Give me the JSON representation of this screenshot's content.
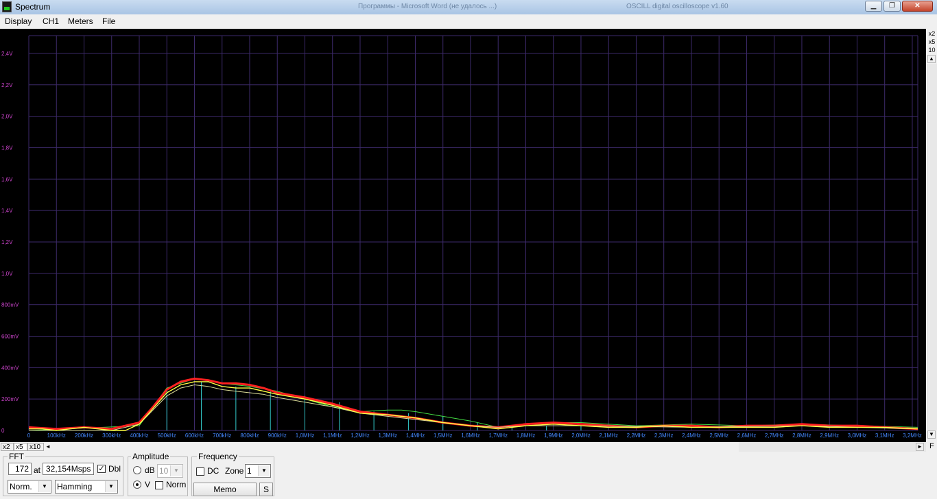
{
  "window": {
    "title": "Spectrum",
    "bg_titles": [
      "Программы - Microsoft Word (не удалось ...)",
      "OSCILL digital oscilloscope v1.60"
    ],
    "minimize_glyph": "▁",
    "maximize_glyph": "❐",
    "close_glyph": "✕"
  },
  "menu": {
    "items": [
      {
        "label": "Display"
      },
      {
        "label": "CH1"
      },
      {
        "label": "Meters"
      },
      {
        "label": "File"
      }
    ]
  },
  "plot": {
    "background": "#000000",
    "grid_color": "#3d2a6b",
    "y_label_color": "#cc44cc",
    "x_label_color": "#4488ff",
    "y_labels": [
      "2,4V",
      "2,2V",
      "2,0V",
      "1,8V",
      "1,6V",
      "1,4V",
      "1,2V",
      "1,0V",
      "800mV",
      "600mV",
      "400mV",
      "200mV",
      "0"
    ],
    "x_labels": [
      "0",
      "100kHz",
      "200kHz",
      "300kHz",
      "400kHz",
      "500kHz",
      "600kHz",
      "700kHz",
      "800kHz",
      "900kHz",
      "1,0MHz",
      "1,1MHz",
      "1,2MHz",
      "1,3MHz",
      "1,4MHz",
      "1,5MHz",
      "1,6MHz",
      "1,7MHz",
      "1,8MHz",
      "1,9MHz",
      "2,0MHz",
      "2,1MHz",
      "2,2MHz",
      "2,3MHz",
      "2,4MHz",
      "2,5MHz",
      "2,6MHz",
      "2,7MHz",
      "2,8MHz",
      "2,9MHz",
      "3,0MHz",
      "3,1MHz",
      "3,2MHz"
    ]
  },
  "chart_data": {
    "type": "line",
    "xlabel": "",
    "ylabel": "",
    "xlim": [
      0,
      3.22
    ],
    "ylim": [
      0,
      2.5
    ],
    "x_unit": "MHz",
    "y_unit": "V",
    "series": [
      {
        "color": "#ff2020",
        "x": [
          0,
          0.1,
          0.2,
          0.3,
          0.4,
          0.45,
          0.5,
          0.55,
          0.6,
          0.65,
          0.7,
          0.75,
          0.8,
          0.85,
          0.9,
          1.0,
          1.1,
          1.2,
          1.3,
          1.4,
          1.5,
          1.6,
          1.7,
          1.8,
          1.9,
          2.0,
          2.1,
          2.2,
          2.3,
          2.4,
          2.5,
          2.6,
          2.7,
          2.8,
          2.9,
          3.0,
          3.1,
          3.22
        ],
        "y": [
          0.02,
          0.01,
          0.02,
          0.01,
          0.05,
          0.15,
          0.26,
          0.31,
          0.33,
          0.32,
          0.3,
          0.3,
          0.29,
          0.27,
          0.24,
          0.21,
          0.17,
          0.12,
          0.1,
          0.08,
          0.05,
          0.03,
          0.02,
          0.04,
          0.05,
          0.04,
          0.03,
          0.02,
          0.03,
          0.03,
          0.02,
          0.03,
          0.03,
          0.04,
          0.03,
          0.03,
          0.02,
          0.01
        ]
      },
      {
        "color": "#ffff44",
        "x": [
          0,
          0.05,
          0.1,
          0.15,
          0.2,
          0.25,
          0.3,
          0.35,
          0.4,
          0.45,
          0.5,
          0.55,
          0.6,
          0.65,
          0.7,
          0.75,
          0.8,
          0.85,
          0.9,
          1.0,
          1.1,
          1.2,
          1.3,
          1.4,
          1.5,
          1.6,
          1.7,
          1.8,
          1.9,
          2.0,
          2.1,
          2.2,
          2.3,
          2.4,
          2.5,
          2.6,
          2.7,
          2.8,
          2.9,
          3.0,
          3.1,
          3.22
        ],
        "y": [
          0.01,
          0.01,
          0.0,
          0.01,
          0.02,
          0.01,
          0.0,
          0.0,
          0.04,
          0.14,
          0.24,
          0.29,
          0.31,
          0.31,
          0.28,
          0.27,
          0.27,
          0.25,
          0.23,
          0.2,
          0.16,
          0.11,
          0.1,
          0.08,
          0.05,
          0.03,
          0.01,
          0.03,
          0.04,
          0.03,
          0.02,
          0.02,
          0.03,
          0.02,
          0.02,
          0.02,
          0.02,
          0.03,
          0.02,
          0.02,
          0.02,
          0.01
        ]
      },
      {
        "color": "#dddd99",
        "x": [
          0,
          0.3,
          0.4,
          0.45,
          0.5,
          0.55,
          0.6,
          0.65,
          0.7,
          0.75,
          0.8,
          0.85,
          0.9,
          1.0,
          1.1,
          1.2,
          1.3,
          1.4,
          1.5,
          1.6,
          1.7,
          1.8,
          2.0,
          2.4,
          2.8,
          3.22
        ],
        "y": [
          0.0,
          0.0,
          0.04,
          0.13,
          0.22,
          0.27,
          0.29,
          0.28,
          0.26,
          0.25,
          0.24,
          0.23,
          0.21,
          0.18,
          0.15,
          0.11,
          0.09,
          0.07,
          0.05,
          0.03,
          0.02,
          0.03,
          0.03,
          0.02,
          0.03,
          0.01
        ]
      },
      {
        "color": "#44dd44",
        "x": [
          0,
          0.4,
          0.5,
          0.6,
          0.7,
          0.8,
          0.9,
          1.0,
          1.1,
          1.2,
          1.3,
          1.35,
          1.4,
          1.5,
          1.6,
          1.7,
          1.8,
          1.9,
          2.0,
          2.2,
          2.4,
          2.6,
          2.8,
          3.0,
          3.22
        ],
        "y": [
          0.0,
          0.03,
          0.27,
          0.33,
          0.3,
          0.28,
          0.25,
          0.2,
          0.15,
          0.12,
          0.13,
          0.13,
          0.12,
          0.09,
          0.06,
          0.02,
          0.04,
          0.05,
          0.05,
          0.03,
          0.04,
          0.03,
          0.04,
          0.03,
          0.02
        ]
      }
    ],
    "stems": {
      "color": "#33cccc",
      "x": [
        0.5,
        0.625,
        0.75,
        0.875,
        1.0,
        1.125,
        1.25,
        1.375,
        1.5,
        1.625,
        1.75,
        1.875,
        2.0
      ],
      "y": [
        0.26,
        0.31,
        0.28,
        0.26,
        0.22,
        0.18,
        0.12,
        0.11,
        0.09,
        0.05,
        0.02,
        0.03,
        0.03
      ]
    }
  },
  "zoom_y": [
    "x2",
    "x5",
    "10"
  ],
  "zoom_x": [
    "x2",
    "x5",
    "x10"
  ],
  "zoom_x_active": "x5",
  "scroll": {
    "left_arrow": "◄",
    "right_arrow": "►",
    "up_arrow": "▲",
    "down_arrow": "▼",
    "corner": "F"
  },
  "fft": {
    "label": "FFT",
    "size": "172",
    "at_label": "at",
    "rate": "32,154Msps",
    "dbl_label": "Dbl",
    "dbl_checked": true,
    "mode": "Norm.",
    "window": "Hamming"
  },
  "amplitude": {
    "label": "Amplitude",
    "db_label": "dB",
    "db_value": "10",
    "v_label": "V",
    "v_selected": true,
    "norm_label": "Norm"
  },
  "frequency": {
    "label": "Frequency",
    "dc_label": "DC",
    "zone_label": "Zone",
    "zone_value": "1",
    "memo_label": "Memo",
    "s_label": "S"
  }
}
